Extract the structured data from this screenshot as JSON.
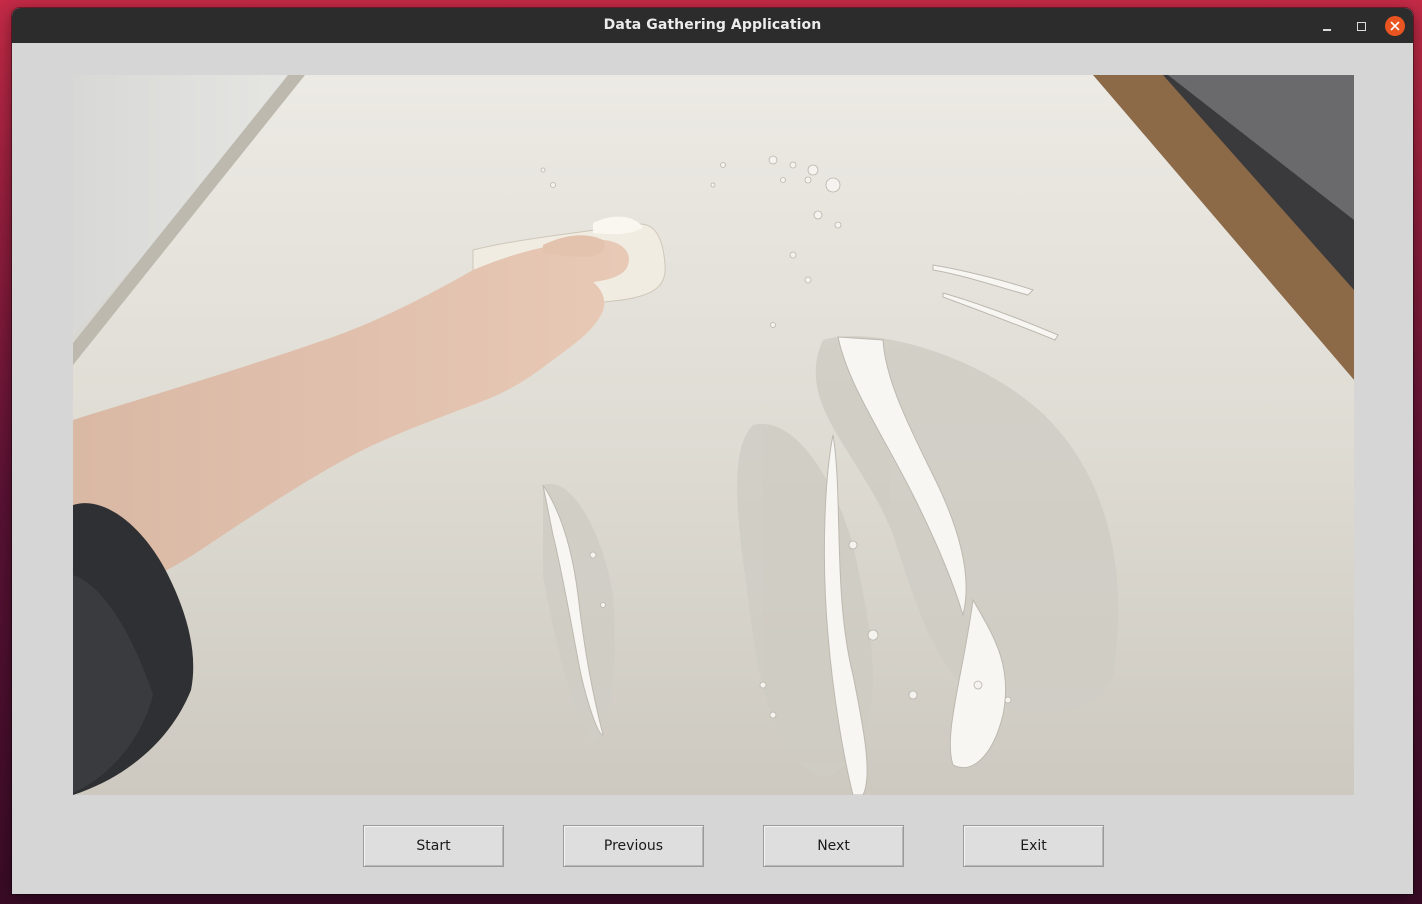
{
  "window": {
    "title": "Data Gathering Application"
  },
  "titlebar_controls": {
    "minimize_icon": "minimize-icon",
    "maximize_icon": "maximize-icon",
    "close_icon": "close-icon",
    "close_color": "#e95420"
  },
  "main": {
    "image_description_icon": "camera-frame"
  },
  "buttons": {
    "start": "Start",
    "previous": "Previous",
    "next": "Next",
    "exit": "Exit"
  },
  "colors": {
    "titlebar": "#2c2c2c",
    "window_bg": "#d6d6d6",
    "button_bg": "#dedede"
  }
}
